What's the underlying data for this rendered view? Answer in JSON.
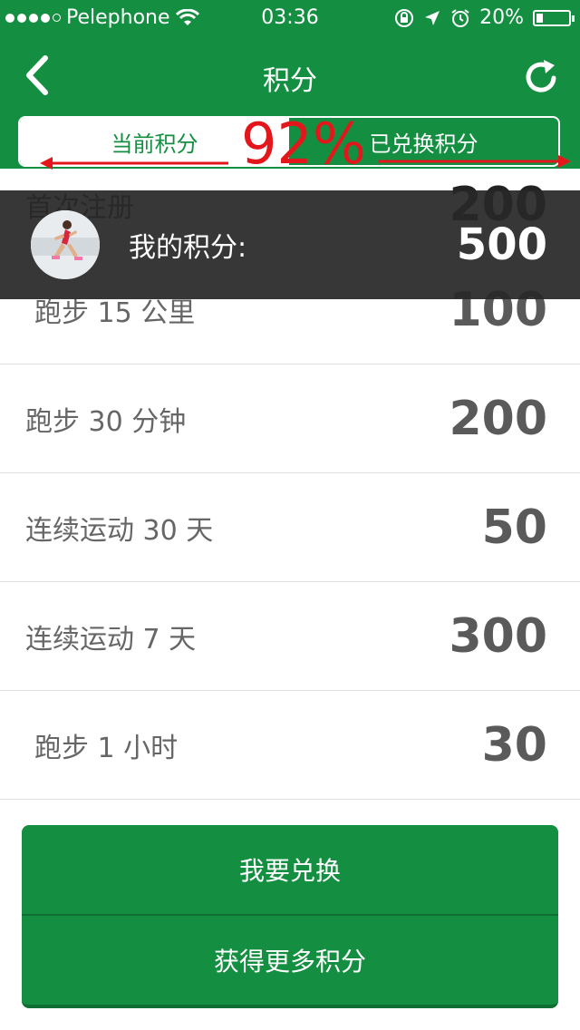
{
  "status_bar": {
    "carrier": "Pelephone",
    "time": "03:36",
    "battery": "20%",
    "battery_level": 0.2,
    "signal_bars_filled": 4,
    "signal_bars_total": 5
  },
  "navbar": {
    "title": "积分",
    "back_icon": "chevron-left-icon",
    "refresh_icon": "refresh-icon"
  },
  "tabs": [
    {
      "label": "当前积分",
      "active": true
    },
    {
      "label": "已兑换积分",
      "active": false
    }
  ],
  "overlay": {
    "percent": "92%",
    "color": "#e3171b"
  },
  "my_points": {
    "label": "我的积分:",
    "value": "500"
  },
  "rows": [
    {
      "label": "首次注册",
      "value": "200"
    },
    {
      "label": "跑步 15 公里",
      "value": "100"
    },
    {
      "label": "跑步 30 分钟",
      "value": "200"
    },
    {
      "label": "连续运动 30 天",
      "value": "50"
    },
    {
      "label": "连续运动 7 天",
      "value": "300"
    },
    {
      "label": "跑步 1 小时",
      "value": "30"
    }
  ],
  "buttons": {
    "redeem": "我要兑换",
    "get_more": "获得更多积分"
  },
  "colors": {
    "brand_green": "#148f41",
    "overlay_dark": "#2a2a2a",
    "value_gray": "#5a5a5a"
  }
}
